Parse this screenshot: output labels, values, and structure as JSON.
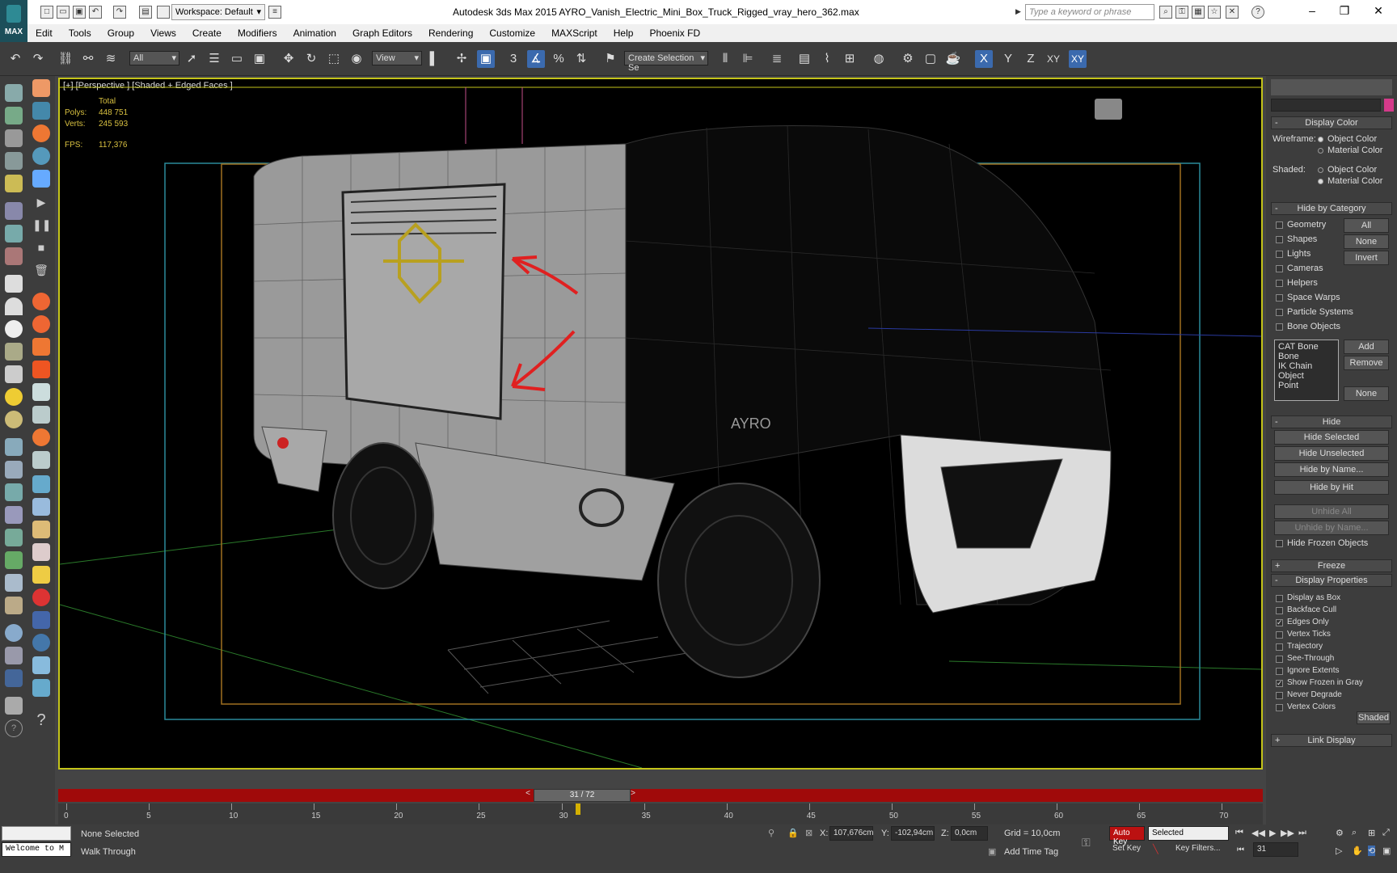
{
  "window": {
    "title": "Autodesk 3ds Max  2015    AYRO_Vanish_Electric_Mini_Box_Truck_Rigged_vray_hero_362.max",
    "logo_label": "MAX",
    "workspace": "Workspace: Default",
    "search_placeholder": "Type a keyword or phrase"
  },
  "menu": [
    "Edit",
    "Tools",
    "Group",
    "Views",
    "Create",
    "Modifiers",
    "Animation",
    "Graph Editors",
    "Rendering",
    "Customize",
    "MAXScript",
    "Help",
    "Phoenix FD"
  ],
  "toolbar": {
    "filter_all": "All",
    "ref_coord": "View",
    "selection_set": "Create Selection Se",
    "axis_x": "X",
    "axis_y": "Y",
    "axis_z": "Z",
    "axis_xy": "XY",
    "axis_xy2": "XY"
  },
  "viewport": {
    "label": "[+] [Perspective ] [Shaded + Edged Faces ]",
    "stats": {
      "total_label": "Total",
      "polys_label": "Polys:",
      "polys": "448 751",
      "verts_label": "Verts:",
      "verts": "245 593",
      "fps_label": "FPS:",
      "fps": "117,376"
    },
    "brand_text": "AYRO"
  },
  "timeline": {
    "slider": "31 / 72",
    "ticks": [
      "0",
      "5",
      "10",
      "15",
      "20",
      "25",
      "30",
      "35",
      "40",
      "45",
      "50",
      "55",
      "60",
      "65",
      "70"
    ],
    "current_frame": 31,
    "total_frames": 72
  },
  "panel": {
    "display_color": {
      "title": "Display Color",
      "wireframe_label": "Wireframe:",
      "shaded_label": "Shaded:",
      "object_color": "Object Color",
      "material_color": "Material Color"
    },
    "hide_by_category": {
      "title": "Hide by Category",
      "items": [
        "Geometry",
        "Shapes",
        "Lights",
        "Cameras",
        "Helpers",
        "Space Warps",
        "Particle Systems",
        "Bone Objects"
      ],
      "btn_all": "All",
      "btn_none": "None",
      "btn_invert": "Invert",
      "list": [
        "CAT Bone",
        "Bone",
        "IK Chain Object",
        "Point"
      ],
      "btn_add": "Add",
      "btn_remove": "Remove",
      "btn_none2": "None"
    },
    "hide": {
      "title": "Hide",
      "hide_selected": "Hide Selected",
      "hide_unselected": "Hide Unselected",
      "hide_by_name": "Hide by Name...",
      "hide_by_hit": "Hide by Hit",
      "unhide_all": "Unhide All",
      "unhide_by_name": "Unhide by Name...",
      "hide_frozen": "Hide Frozen Objects"
    },
    "freeze": {
      "title": "Freeze"
    },
    "display_properties": {
      "title": "Display Properties",
      "items": [
        "Display as Box",
        "Backface Cull",
        "Edges Only",
        "Vertex Ticks",
        "Trajectory",
        "See-Through",
        "Ignore Extents",
        "Show Frozen in Gray",
        "Never Degrade",
        "Vertex Colors"
      ],
      "checked": [
        false,
        false,
        true,
        false,
        false,
        false,
        false,
        true,
        false,
        false
      ],
      "shaded_btn": "Shaded"
    },
    "link_display": {
      "title": "Link Display"
    }
  },
  "status": {
    "welcome": "Welcome to M",
    "none_selected": "None Selected",
    "walk_through": "Walk Through",
    "x_label": "X:",
    "x": "107,676cm",
    "y_label": "Y:",
    "y": "-102,94cm",
    "z_label": "Z:",
    "z": "0,0cm",
    "grid": "Grid = 10,0cm",
    "add_time_tag": "Add Time Tag",
    "auto_key": "Auto Key",
    "selected": "Selected",
    "set_key": "Set Key",
    "key_filters": "Key Filters...",
    "frame": "31"
  }
}
